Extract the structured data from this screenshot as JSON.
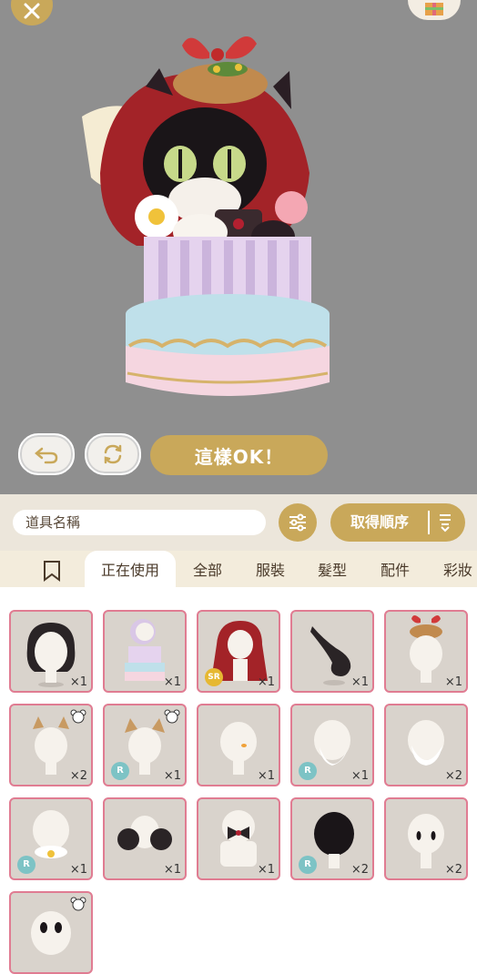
{
  "preview": {
    "ok_label": "這樣OK！"
  },
  "filter": {
    "search_text": "道具名稱",
    "sort_label": "取得順序"
  },
  "tabs": [
    {
      "label": "正在使用",
      "active": true
    },
    {
      "label": "全部"
    },
    {
      "label": "服裝"
    },
    {
      "label": "髮型"
    },
    {
      "label": "配件"
    },
    {
      "label": "彩妝"
    }
  ],
  "items": [
    {
      "name": "black-wavy-hair",
      "qty": "×1"
    },
    {
      "name": "cake-costume",
      "qty": "×1"
    },
    {
      "name": "red-hood-cape",
      "qty": "×1",
      "badge": "SR"
    },
    {
      "name": "black-tail",
      "qty": "×1"
    },
    {
      "name": "pinecone-bow-ornament",
      "qty": "×1"
    },
    {
      "name": "horns-1",
      "qty": "×2",
      "ears": true
    },
    {
      "name": "horns-2",
      "qty": "×1",
      "badge": "R",
      "ears": true
    },
    {
      "name": "face-mark",
      "qty": "×1"
    },
    {
      "name": "beard-1",
      "qty": "×1",
      "badge": "R"
    },
    {
      "name": "beard-2",
      "qty": "×2"
    },
    {
      "name": "collar-flower",
      "qty": "×1",
      "badge": "R"
    },
    {
      "name": "fur-paws",
      "qty": "×1"
    },
    {
      "name": "bowtie",
      "qty": "×1"
    },
    {
      "name": "black-cat-head",
      "qty": "×2",
      "badge": "R"
    },
    {
      "name": "eyes",
      "qty": "×2"
    },
    {
      "name": "ghost-face",
      "qty": "",
      "ears": true
    }
  ],
  "colors": {
    "gold": "#c9a85a",
    "preview_bg": "#8f8f8f",
    "tab_bg": "#f3ecdc",
    "cell_border": "#e07c92"
  },
  "icons": [
    "close-icon",
    "gift-icon",
    "undo-icon",
    "rotate-icon",
    "sliders-icon",
    "sort-icon",
    "bookmark-icon",
    "bear-ears-icon"
  ]
}
